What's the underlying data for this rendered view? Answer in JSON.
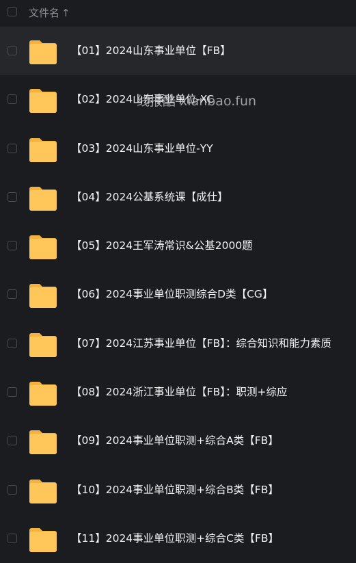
{
  "header": {
    "column_label": "文件名",
    "sort_arrow": "↑"
  },
  "watermark": "线报酷 xianbao.fun",
  "rows": [
    {
      "label": "【01】2024山东事业单位【FB】"
    },
    {
      "label": "【02】2024山东事业单位-XC"
    },
    {
      "label": "【03】2024山东事业单位-YY"
    },
    {
      "label": "【04】2024公基系统课【成仕】"
    },
    {
      "label": "【05】2024王军涛常识&公基2000题"
    },
    {
      "label": "【06】2024事业单位职测综合D类【CG】"
    },
    {
      "label": "【07】2024江苏事业单位【FB】：综合知识和能力素质"
    },
    {
      "label": "【08】2024浙江事业单位【FB】：职测+综应"
    },
    {
      "label": "【09】2024事业单位职测+综合A类【FB】"
    },
    {
      "label": "【10】2024事业单位职测+综合B类【FB】"
    },
    {
      "label": "【11】2024事业单位职测+综合C类【FB】"
    }
  ],
  "colors": {
    "background": "#1b1c20",
    "active_row": "#26272b",
    "folder_body": "#ffc75a",
    "folder_tab": "#f5b23e",
    "text": "#f2f3f5",
    "muted": "#8c8e94"
  },
  "icons": {
    "row_icon": "folder-icon",
    "header_checkbox": "checkbox-icon"
  }
}
